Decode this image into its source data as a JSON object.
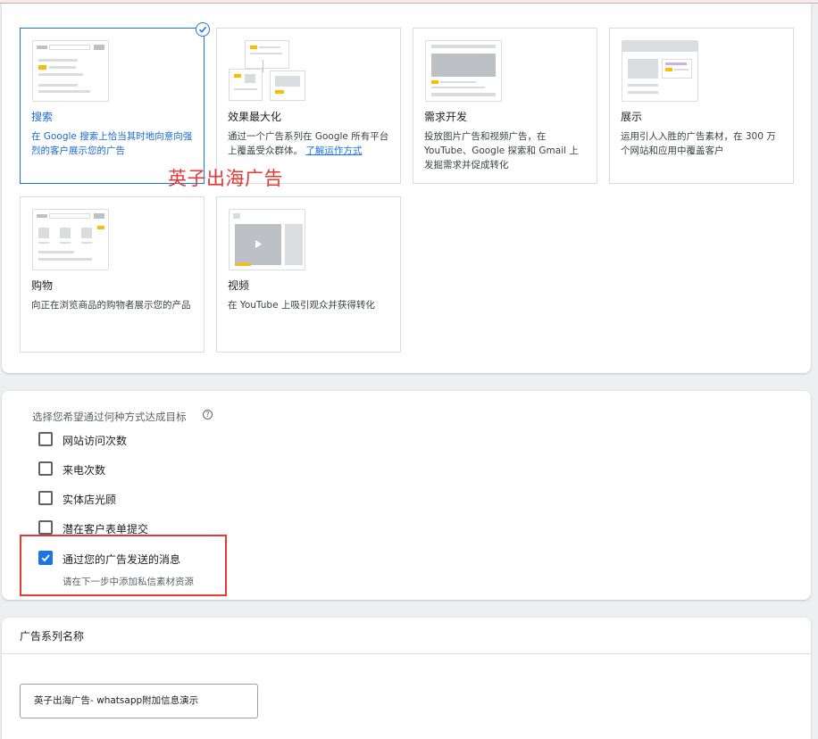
{
  "campaign_types": [
    {
      "title": "搜索",
      "desc": "在 Google 搜索上恰当其时地向意向强烈的客户展示您的广告",
      "selected": true
    },
    {
      "title": "效果最大化",
      "desc": "通过一个广告系列在 Google 所有平台上覆盖受众群体。",
      "link": "了解运作方式"
    },
    {
      "title": "需求开发",
      "desc": "投放图片广告和视频广告，在 YouTube、Google 探索和 Gmail 上发掘需求并促成转化"
    },
    {
      "title": "展示",
      "desc": "运用引人入胜的广告素材，在 300 万个网站和应用中覆盖客户"
    },
    {
      "title": "购物",
      "desc": "向正在浏览商品的购物者展示您的产品"
    },
    {
      "title": "视频",
      "desc": "在 YouTube 上吸引观众并获得转化"
    }
  ],
  "watermark": "英子出海广告",
  "goals": {
    "heading": "选择您希望通过何种方式达成目标",
    "items": [
      {
        "label": "网站访问次数",
        "checked": false
      },
      {
        "label": "来电次数",
        "checked": false
      },
      {
        "label": "实体店光顾",
        "checked": false
      },
      {
        "label": "潜在客户表单提交",
        "checked": false
      },
      {
        "label": "通过您的广告发送的消息",
        "checked": true
      }
    ],
    "checked_sub": "请在下一步中添加私信素材资源"
  },
  "campaign_name": {
    "title": "广告系列名称",
    "value": "英子出海广告- whatsapp附加信息演示"
  },
  "colors": {
    "accent": "#1a73e8",
    "annotation_red": "#e53935",
    "yellow": "#fbbc04"
  }
}
